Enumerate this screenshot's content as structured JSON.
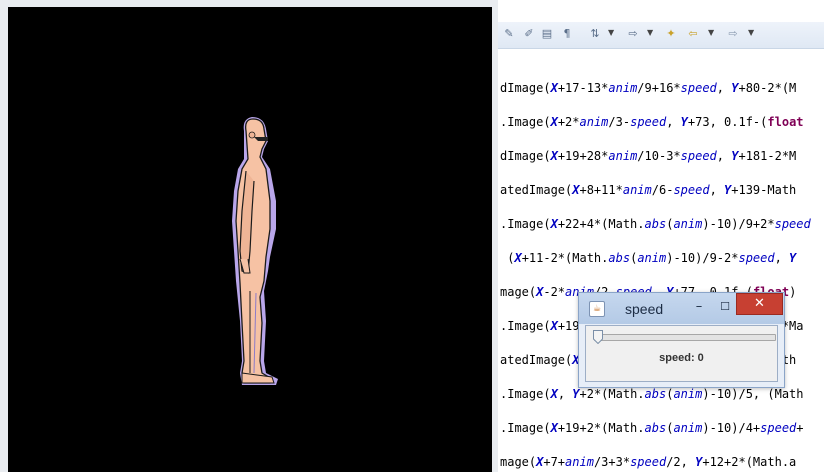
{
  "canvas": {
    "background": "#000000",
    "figure": "standing cartoon man"
  },
  "toolbar": {
    "icons": [
      "edit-icon",
      "annotation-icon",
      "document-icon",
      "paragraph-icon",
      "nav-icon",
      "task-icon",
      "last-edit-icon",
      "back-arrow-icon",
      "forward-arrow-icon"
    ]
  },
  "code_lines": [
    [
      [
        "t",
        "dImage("
      ],
      [
        "v",
        "X"
      ],
      [
        "t",
        "+17-13*"
      ],
      [
        "f",
        "anim"
      ],
      [
        "t",
        "/9+16*"
      ],
      [
        "f",
        "speed"
      ],
      [
        "t",
        ", "
      ],
      [
        "v",
        "Y"
      ],
      [
        "t",
        "+80-2*(M"
      ]
    ],
    [
      [
        "t",
        ".Image("
      ],
      [
        "v",
        "X"
      ],
      [
        "t",
        "+2*"
      ],
      [
        "f",
        "anim"
      ],
      [
        "t",
        "/3-"
      ],
      [
        "f",
        "speed"
      ],
      [
        "t",
        ", "
      ],
      [
        "v",
        "Y"
      ],
      [
        "t",
        "+73, 0.1f-("
      ],
      [
        "kw",
        "float"
      ]
    ],
    [
      [
        "t",
        "dImage("
      ],
      [
        "v",
        "X"
      ],
      [
        "t",
        "+19+28*"
      ],
      [
        "f",
        "anim"
      ],
      [
        "t",
        "/10-3*"
      ],
      [
        "f",
        "speed"
      ],
      [
        "t",
        ", "
      ],
      [
        "v",
        "Y"
      ],
      [
        "t",
        "+181-2*M"
      ]
    ],
    [
      [
        "t",
        "atedImage("
      ],
      [
        "v",
        "X"
      ],
      [
        "t",
        "+8+11*"
      ],
      [
        "f",
        "anim"
      ],
      [
        "t",
        "/6-"
      ],
      [
        "f",
        "speed"
      ],
      [
        "t",
        ", "
      ],
      [
        "v",
        "Y"
      ],
      [
        "t",
        "+139-Math"
      ]
    ],
    [
      [
        "t",
        ".Image("
      ],
      [
        "v",
        "X"
      ],
      [
        "t",
        "+22+4*(Math."
      ],
      [
        "f",
        "abs"
      ],
      [
        "t",
        "("
      ],
      [
        "f",
        "anim"
      ],
      [
        "t",
        ")-10)/9+2*"
      ],
      [
        "f",
        "speed"
      ]
    ],
    [
      [
        "t",
        " ("
      ],
      [
        "v",
        "X"
      ],
      [
        "t",
        "+11-2*(Math."
      ],
      [
        "f",
        "abs"
      ],
      [
        "t",
        "("
      ],
      [
        "f",
        "anim"
      ],
      [
        "t",
        ")-10)/9-2*"
      ],
      [
        "f",
        "speed"
      ],
      [
        "t",
        ", "
      ],
      [
        "v",
        "Y"
      ]
    ],
    [
      [
        "t",
        "mage("
      ],
      [
        "v",
        "X"
      ],
      [
        "t",
        "-2*"
      ],
      [
        "f",
        "anim"
      ],
      [
        "t",
        "/2-"
      ],
      [
        "f",
        "speed"
      ],
      [
        "t",
        ", "
      ],
      [
        "v",
        "Y"
      ],
      [
        "t",
        "+77, 0.1f-("
      ],
      [
        "kw",
        "float"
      ],
      [
        "t",
        ")"
      ]
    ],
    [
      [
        "t",
        ".Image("
      ],
      [
        "v",
        "X"
      ],
      [
        "t",
        "+19+28*"
      ],
      [
        "f",
        "anim"
      ],
      [
        "t",
        "/10-3*"
      ],
      [
        "f",
        "speed"
      ],
      [
        "t",
        ", "
      ],
      [
        "v",
        "Y"
      ],
      [
        "t",
        "+181-2*Ma"
      ]
    ],
    [
      [
        "t",
        "atedImage("
      ],
      [
        "v",
        "X"
      ],
      [
        "t",
        "+8+11*"
      ],
      [
        "f",
        "anim"
      ],
      [
        "t",
        "/6-"
      ],
      [
        "f",
        "speed"
      ],
      [
        "t",
        ", "
      ],
      [
        "v",
        "Y"
      ],
      [
        "t",
        "+139-Math"
      ]
    ],
    [
      [
        "t",
        ".Image("
      ],
      [
        "v",
        "X"
      ],
      [
        "t",
        ", "
      ],
      [
        "v",
        "Y"
      ],
      [
        "t",
        "+2*(Math."
      ],
      [
        "f",
        "abs"
      ],
      [
        "t",
        "("
      ],
      [
        "f",
        "anim"
      ],
      [
        "t",
        ")-10)/5, (Math"
      ]
    ],
    [
      [
        "t",
        ".Image("
      ],
      [
        "v",
        "X"
      ],
      [
        "t",
        "+19+2*(Math."
      ],
      [
        "f",
        "abs"
      ],
      [
        "t",
        "("
      ],
      [
        "f",
        "anim"
      ],
      [
        "t",
        ")-10)/4+"
      ],
      [
        "f",
        "speed"
      ],
      [
        "t",
        "+"
      ]
    ],
    [
      [
        "t",
        "mage("
      ],
      [
        "v",
        "X"
      ],
      [
        "t",
        "+7+"
      ],
      [
        "f",
        "anim"
      ],
      [
        "t",
        "/3+3*"
      ],
      [
        "f",
        "speed"
      ],
      [
        "t",
        "/2, "
      ],
      [
        "v",
        "Y"
      ],
      [
        "t",
        "+12+2*(Math.a"
      ]
    ]
  ],
  "dialog": {
    "title": "speed",
    "minimize_glyph": "–",
    "maximize_glyph": "☐",
    "close_glyph": "✕",
    "speed_label": "speed: 0",
    "slider_value": 0
  }
}
